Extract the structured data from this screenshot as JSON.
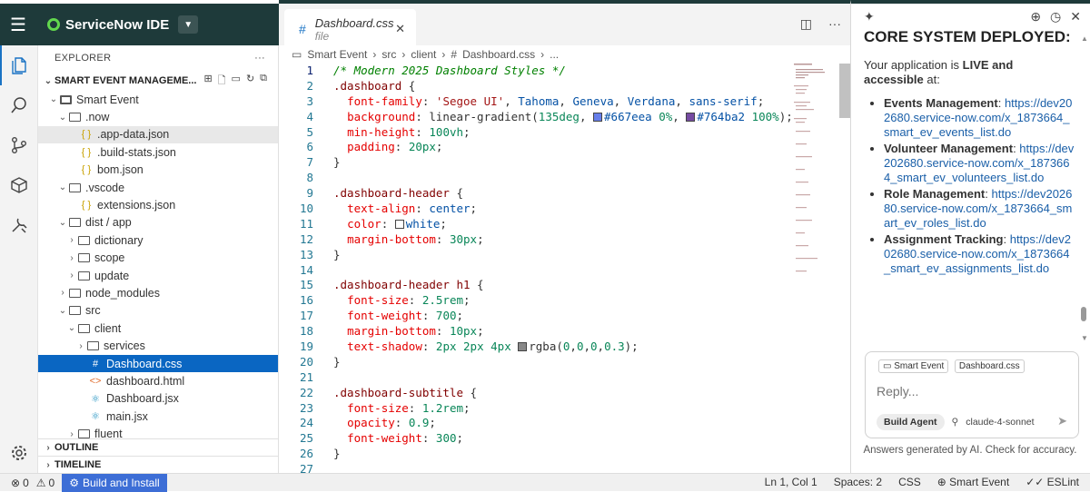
{
  "app": {
    "title": "ServiceNow IDE"
  },
  "explorer": {
    "title": "EXPLORER",
    "project": "SMART EVENT MANAGEME...",
    "tree": [
      {
        "label": "Smart Event",
        "depth": 1,
        "type": "app",
        "open": true
      },
      {
        "label": ".now",
        "depth": 2,
        "type": "folder",
        "open": true
      },
      {
        "label": ".app-data.json",
        "depth": 3,
        "type": "json",
        "highlight": true
      },
      {
        "label": ".build-stats.json",
        "depth": 3,
        "type": "json"
      },
      {
        "label": "bom.json",
        "depth": 3,
        "type": "json"
      },
      {
        "label": ".vscode",
        "depth": 2,
        "type": "folder",
        "open": true
      },
      {
        "label": "extensions.json",
        "depth": 3,
        "type": "json"
      },
      {
        "label": "dist / app",
        "depth": 2,
        "type": "folder",
        "open": true
      },
      {
        "label": "dictionary",
        "depth": 3,
        "type": "folder",
        "open": false
      },
      {
        "label": "scope",
        "depth": 3,
        "type": "folder",
        "open": false
      },
      {
        "label": "update",
        "depth": 3,
        "type": "folder",
        "open": false
      },
      {
        "label": "node_modules",
        "depth": 2,
        "type": "folder",
        "open": false
      },
      {
        "label": "src",
        "depth": 2,
        "type": "folder",
        "open": true
      },
      {
        "label": "client",
        "depth": 3,
        "type": "folder",
        "open": true
      },
      {
        "label": "services",
        "depth": 4,
        "type": "folder",
        "open": false
      },
      {
        "label": "Dashboard.css",
        "depth": 4,
        "type": "css",
        "selected": true
      },
      {
        "label": "dashboard.html",
        "depth": 4,
        "type": "html"
      },
      {
        "label": "Dashboard.jsx",
        "depth": 4,
        "type": "jsx"
      },
      {
        "label": "main.jsx",
        "depth": 4,
        "type": "jsx"
      },
      {
        "label": "fluent",
        "depth": 3,
        "type": "folder",
        "open": false
      }
    ],
    "outline": "OUTLINE",
    "timeline": "TIMELINE"
  },
  "tab": {
    "name": "Dashboard.css",
    "sub": "file"
  },
  "breadcrumb": [
    "Smart Event",
    "src",
    "client",
    "Dashboard.css",
    "..."
  ],
  "editor": {
    "line_numbers": [
      "1",
      "2",
      "3",
      "4",
      "5",
      "6",
      "7",
      "8",
      "9",
      "10",
      "11",
      "12",
      "13",
      "14",
      "15",
      "16",
      "17",
      "18",
      "19",
      "20",
      "21",
      "22",
      "23",
      "24",
      "25",
      "26",
      "27"
    ],
    "lines": [
      "/* Modern 2025 Dashboard Styles */",
      ".dashboard {",
      "  font-family: 'Segoe UI', Tahoma, Geneva, Verdana, sans-serif;",
      "  background: linear-gradient(135deg, #667eea 0%, #764ba2 100%);",
      "  min-height: 100vh;",
      "  padding: 20px;",
      "}",
      "",
      ".dashboard-header {",
      "  text-align: center;",
      "  color: white;",
      "  margin-bottom: 30px;",
      "}",
      "",
      ".dashboard-header h1 {",
      "  font-size: 2.5rem;",
      "  font-weight: 700;",
      "  margin-bottom: 10px;",
      "  text-shadow: 2px 2px 4px rgba(0,0,0,0.3);",
      "}",
      "",
      ".dashboard-subtitle {",
      "  font-size: 1.2rem;",
      "  opacity: 0.9;",
      "  font-weight: 300;",
      "}",
      ""
    ]
  },
  "chat": {
    "heading": "CORE SYSTEM DEPLOYED:",
    "intro_a": "Your application is ",
    "intro_b": "LIVE and accessible",
    "intro_c": " at:",
    "items": [
      {
        "label": "Events Management",
        "url": "https://dev202680.service-now.com/x_1873664_smart_ev_events_list.do"
      },
      {
        "label": "Volunteer Management",
        "url": "https://dev202680.service-now.com/x_1873664_smart_ev_volunteers_list.do"
      },
      {
        "label": "Role Management",
        "url": "https://dev202680.service-now.com/x_1873664_smart_ev_roles_list.do"
      },
      {
        "label": "Assignment Tracking",
        "url": "https://dev202680.service-now.com/x_1873664_smart_ev_assignments_list.do"
      }
    ],
    "chips": [
      "Smart Event",
      "Dashboard.css"
    ],
    "placeholder": "Reply...",
    "mode": "Build Agent",
    "model": "claude-4-sonnet",
    "disclaimer": "Answers generated by AI. Check for accuracy."
  },
  "status": {
    "errors": "0",
    "warnings": "0",
    "build": "Build and Install",
    "position": "Ln 1, Col 1",
    "spaces": "Spaces: 2",
    "lang": "CSS",
    "app": "Smart Event",
    "lint": "ESLint"
  },
  "colors": {
    "accent": "#0a66c2",
    "brand": "#62d84e",
    "topbar": "#1e3a3a",
    "swatch1": "#667eea",
    "swatch2": "#764ba2"
  }
}
